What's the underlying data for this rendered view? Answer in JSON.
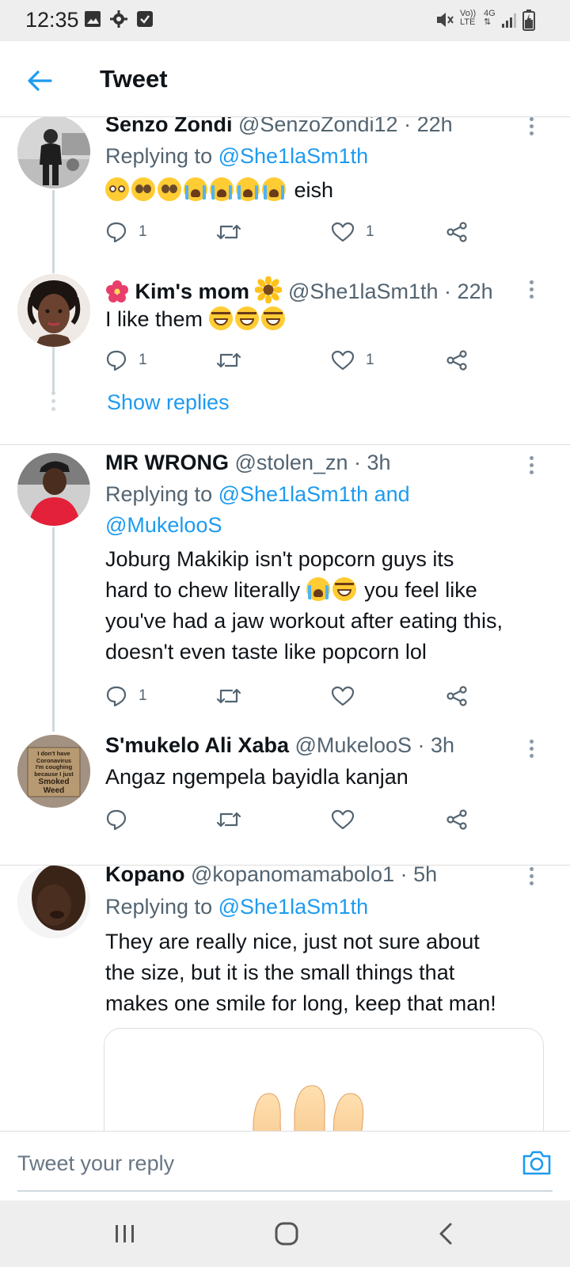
{
  "status_bar": {
    "time": "12:35",
    "left_icons": [
      "gallery-icon",
      "gear-icon",
      "checkbox-icon"
    ],
    "volte_label_top": "Vo))",
    "volte_label_bottom": "LTE",
    "network_label": "4G"
  },
  "header": {
    "title": "Tweet"
  },
  "tweets": [
    {
      "name": "Senzo Zondi",
      "handle": "@SenzoZondi12",
      "separator": "·",
      "time": "22h",
      "replying_to_prefix": "Replying to",
      "replying_to": "@She1laSm1th",
      "body_text": "eish",
      "emojis": [
        "flushed-face",
        "pleading-face",
        "pleading-face",
        "loudly-crying-face",
        "loudly-crying-face",
        "loudly-crying-face",
        "loudly-crying-face"
      ],
      "reply_count": "1",
      "retweet_count": "",
      "like_count": "1"
    },
    {
      "name_prefix_emoji": "hibiscus",
      "name": "Kim's mom",
      "name_suffix_emoji": "sunflower",
      "handle": "@She1laSm1th",
      "separator": "·",
      "time": "22h",
      "body_text": "I like them",
      "emojis": [
        "tears-of-joy-face",
        "tears-of-joy-face",
        "tears-of-joy-face"
      ],
      "reply_count": "1",
      "retweet_count": "",
      "like_count": "1",
      "show_replies": "Show replies"
    },
    {
      "name": "MR WRONG",
      "handle": "@stolen_zn",
      "separator": "·",
      "time": "3h",
      "replying_to_prefix": "Replying to",
      "replying_to": "@She1laSm1th",
      "replying_to_conjunction": "and",
      "replying_to_2": "@MukelooS",
      "body_line1": "Joburg Makikip isn't popcorn guys its",
      "body_line2": "hard to chew literally",
      "body_line2_emojis": [
        "loudly-crying-face",
        "tears-of-joy-face"
      ],
      "body_line2_tail": "you feel like",
      "body_line3": "you've had a jaw workout after eating this,",
      "body_line4": "doesn't even taste like popcorn lol",
      "reply_count": "1",
      "retweet_count": "",
      "like_count": ""
    },
    {
      "name": "S'mukelo Ali Xaba",
      "handle": "@MukelooS",
      "separator": "·",
      "time": "3h",
      "avatar_sign_line1": "I don't have",
      "avatar_sign_line2": "Coronavirus",
      "avatar_sign_line3": "I'm coughing",
      "avatar_sign_line4": "because I just",
      "avatar_sign_line5": "Smoked",
      "avatar_sign_line6": "Weed",
      "body_text": "Angaz ngempela bayidla kanjan",
      "reply_count": "",
      "retweet_count": "",
      "like_count": ""
    },
    {
      "name": "Kopano",
      "handle": "@kopanomamabolo1",
      "separator": "·",
      "time": "5h",
      "replying_to_prefix": "Replying to",
      "replying_to": "@She1laSm1th",
      "body_line1": "They are really nice, just not sure about",
      "body_line2": "the size, but it is the small things that",
      "body_line3": "makes one smile for long, keep that man!",
      "media": "hand-emoji-image"
    }
  ],
  "reply_bar": {
    "placeholder": "Tweet your reply"
  },
  "nav_bar": {
    "buttons": [
      "recent-apps-icon",
      "home-icon",
      "back-icon"
    ]
  },
  "colors": {
    "accent": "#1d9bf0",
    "text_primary": "#0f1419",
    "text_secondary": "#536471",
    "divider": "#dedede",
    "system_bar": "#eeeeee"
  }
}
